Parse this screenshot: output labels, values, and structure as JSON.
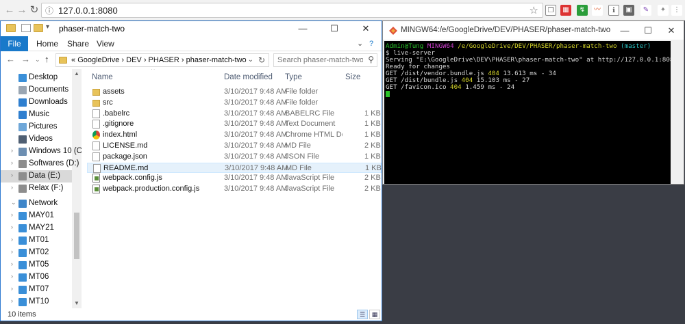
{
  "browser": {
    "url": "127.0.0.1:8080",
    "back_icon": "back-arrow-icon",
    "forward_icon": "forward-arrow-icon",
    "reload_icon": "reload-icon",
    "star_icon": "star-icon",
    "info_icon": "info-icon"
  },
  "explorer": {
    "title": "phaser-match-two",
    "controls": {
      "minimize": "—",
      "maximize": "☐",
      "close": "✕"
    },
    "ribbon": {
      "file": "File",
      "tabs": [
        "Home",
        "Share",
        "View"
      ]
    },
    "address": {
      "prefix": "«",
      "crumbs": [
        "GoogleDrive",
        "DEV",
        "PHASER",
        "phaser-match-two"
      ],
      "separator": "›"
    },
    "search_placeholder": "Search phaser-match-two",
    "nav": [
      {
        "label": "Desktop",
        "color": "#3a8fd8",
        "arrow": ""
      },
      {
        "label": "Documents",
        "color": "#9aa6b3",
        "arrow": ""
      },
      {
        "label": "Downloads",
        "color": "#2f7fcf",
        "arrow": ""
      },
      {
        "label": "Music",
        "color": "#2f7fcf",
        "arrow": ""
      },
      {
        "label": "Pictures",
        "color": "#6fa7d8",
        "arrow": ""
      },
      {
        "label": "Videos",
        "color": "#4f5f73",
        "arrow": ""
      },
      {
        "label": "Windows 10 (C:)",
        "color": "#6d8fb2",
        "arrow": "›"
      },
      {
        "label": "Softwares (D:)",
        "color": "#8d8d8d",
        "arrow": "›"
      },
      {
        "label": "Data (E:)",
        "color": "#8d8d8d",
        "arrow": "›",
        "selected": true
      },
      {
        "label": "Relax (F:)",
        "color": "#8d8d8d",
        "arrow": "›"
      },
      {
        "label": "Network",
        "color": "#3f86c9",
        "arrow": "⌄"
      },
      {
        "label": "MAY01",
        "color": "#3a8fd8",
        "arrow": "›"
      },
      {
        "label": "MAY21",
        "color": "#3a8fd8",
        "arrow": "›"
      },
      {
        "label": "MT01",
        "color": "#3a8fd8",
        "arrow": "›"
      },
      {
        "label": "MT02",
        "color": "#3a8fd8",
        "arrow": "›"
      },
      {
        "label": "MT05",
        "color": "#3a8fd8",
        "arrow": "›"
      },
      {
        "label": "MT06",
        "color": "#3a8fd8",
        "arrow": "›"
      },
      {
        "label": "MT07",
        "color": "#3a8fd8",
        "arrow": "›"
      },
      {
        "label": "MT10",
        "color": "#3a8fd8",
        "arrow": "›"
      },
      {
        "label": "MT11",
        "color": "#3a8fd8",
        "arrow": "›"
      }
    ],
    "columns": [
      "Name",
      "Date modified",
      "Type",
      "Size"
    ],
    "files": [
      {
        "name": "assets",
        "date": "3/10/2017 9:48 AM",
        "type": "File folder",
        "size": "",
        "icon": "folder"
      },
      {
        "name": "src",
        "date": "3/10/2017 9:48 AM",
        "type": "File folder",
        "size": "",
        "icon": "folder"
      },
      {
        "name": ".babelrc",
        "date": "3/10/2017 9:48 AM",
        "type": "BABELRC File",
        "size": "1 KB",
        "icon": "doc"
      },
      {
        "name": ".gitignore",
        "date": "3/10/2017 9:48 AM",
        "type": "Text Document",
        "size": "1 KB",
        "icon": "doc"
      },
      {
        "name": "index.html",
        "date": "3/10/2017 9:48 AM",
        "type": "Chrome HTML Do...",
        "size": "1 KB",
        "icon": "chrome"
      },
      {
        "name": "LICENSE.md",
        "date": "3/10/2017 9:48 AM",
        "type": "MD File",
        "size": "2 KB",
        "icon": "doc"
      },
      {
        "name": "package.json",
        "date": "3/10/2017 9:48 AM",
        "type": "JSON File",
        "size": "1 KB",
        "icon": "doc"
      },
      {
        "name": "README.md",
        "date": "3/10/2017 9:48 AM",
        "type": "MD File",
        "size": "1 KB",
        "icon": "doc",
        "selected": true
      },
      {
        "name": "webpack.config.js",
        "date": "3/10/2017 9:48 AM",
        "type": "JavaScript File",
        "size": "2 KB",
        "icon": "js"
      },
      {
        "name": "webpack.production.config.js",
        "date": "3/10/2017 9:48 AM",
        "type": "JavaScript File",
        "size": "2 KB",
        "icon": "js"
      }
    ],
    "status": "10 items"
  },
  "terminal": {
    "title": "MINGW64:/e/GoogleDrive/DEV/PHASER/phaser-match-two",
    "controls": {
      "minimize": "—",
      "maximize": "☐",
      "close": "✕"
    },
    "prompt": {
      "user": "Admin@Tung",
      "env": "MINGW64",
      "path": "/e/GoogleDrive/DEV/PHASER/phaser-match-two",
      "branch": "(master)"
    },
    "command": "$ live-server",
    "output": [
      {
        "text": "Serving \"E:\\GoogleDrive\\DEV\\PHASER\\phaser-match-two\" at http://127.0.0.1:8080"
      },
      {
        "text": "Ready for changes"
      },
      {
        "pre": "GET /dist/vendor.bundle.js ",
        "code": "404",
        "post": " 13.613 ms - 34"
      },
      {
        "pre": "GET /dist/bundle.js ",
        "code": "404",
        "post": " 15.103 ms - 27"
      },
      {
        "pre": "GET /favicon.ico ",
        "code": "404",
        "post": " 1.459 ms - 24"
      }
    ]
  }
}
